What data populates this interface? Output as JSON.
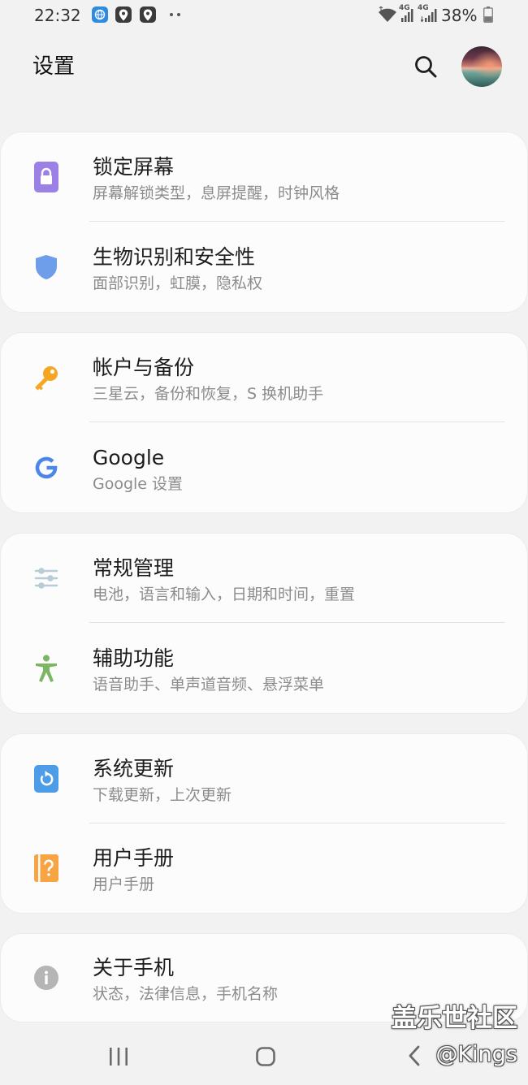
{
  "status_bar": {
    "time": "22:32",
    "notification_icons": [
      "browser-icon",
      "location-pin-icon",
      "location-pin-icon",
      "more-dots-icon"
    ],
    "wifi_icon": "wifi-icon",
    "network_labels": [
      "4G",
      "4G"
    ],
    "battery": "38%",
    "battery_level": 0.38
  },
  "header": {
    "title": "设置",
    "search_icon": "search-icon",
    "avatar_icon": "avatar"
  },
  "groups": [
    {
      "items": [
        {
          "title": "锁定屏幕",
          "subtitle": "屏幕解锁类型，息屏提醒，时钟风格",
          "icon": "lock-icon",
          "icon_color": "#9b80e6"
        },
        {
          "title": "生物识别和安全性",
          "subtitle": "面部识别，虹膜，隐私权",
          "icon": "shield-icon",
          "icon_color": "#6e9de9"
        }
      ]
    },
    {
      "items": [
        {
          "title": "帐户与备份",
          "subtitle": "三星云，备份和恢复，S 换机助手",
          "icon": "key-icon",
          "icon_color": "#f5a623"
        },
        {
          "title": "Google",
          "subtitle": "Google 设置",
          "icon": "google-icon",
          "icon_color": "#4b86e8"
        }
      ]
    },
    {
      "items": [
        {
          "title": "常规管理",
          "subtitle": "电池，语言和输入，日期和时间，重置",
          "icon": "sliders-icon",
          "icon_color": "#b7ccd4"
        },
        {
          "title": "辅助功能",
          "subtitle": "语音助手、单声道音频、悬浮菜单",
          "icon": "accessibility-icon",
          "icon_color": "#7cb663"
        }
      ]
    },
    {
      "items": [
        {
          "title": "系统更新",
          "subtitle": "下载更新，上次更新",
          "icon": "update-icon",
          "icon_color": "#4c9ce8"
        },
        {
          "title": "用户手册",
          "subtitle": "用户手册",
          "icon": "manual-icon",
          "icon_color": "#f6a444"
        }
      ]
    },
    {
      "items": [
        {
          "title": "关于手机",
          "subtitle": "状态，法律信息，手机名称",
          "icon": "info-icon",
          "icon_color": "#b5b5b5"
        }
      ]
    }
  ],
  "nav_bar": {
    "recent_icon": "recent-apps-icon",
    "home_icon": "home-icon",
    "back_icon": "back-icon",
    "icon_color": "#6b6b6b"
  },
  "watermark": {
    "line1": "盖乐世社区",
    "line2": "@Kings"
  }
}
